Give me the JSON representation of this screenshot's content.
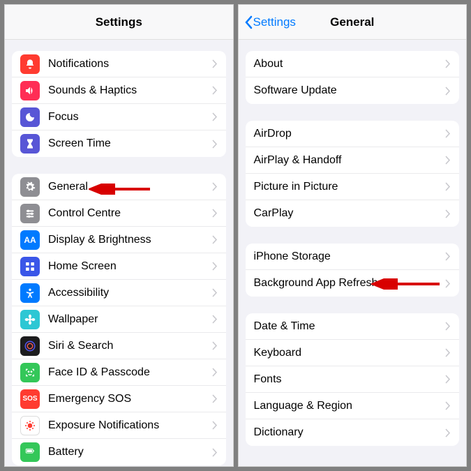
{
  "left": {
    "title": "Settings",
    "group1": [
      {
        "label": "Notifications",
        "bg": "#ff3b30",
        "icon": "bell"
      },
      {
        "label": "Sounds & Haptics",
        "bg": "#ff2d55",
        "icon": "speaker"
      },
      {
        "label": "Focus",
        "bg": "#5856d6",
        "icon": "moon"
      },
      {
        "label": "Screen Time",
        "bg": "#5856d6",
        "icon": "hourglass"
      }
    ],
    "group2": [
      {
        "label": "General",
        "bg": "#8e8e93",
        "icon": "gear"
      },
      {
        "label": "Control Centre",
        "bg": "#8e8e93",
        "icon": "sliders"
      },
      {
        "label": "Display & Brightness",
        "bg": "#007aff",
        "icon": "aa"
      },
      {
        "label": "Home Screen",
        "bg": "#3a56e8",
        "icon": "grid"
      },
      {
        "label": "Accessibility",
        "bg": "#007aff",
        "icon": "person"
      },
      {
        "label": "Wallpaper",
        "bg": "#2dc7d4",
        "icon": "flower"
      },
      {
        "label": "Siri & Search",
        "bg": "#1c1c1e",
        "icon": "siri"
      },
      {
        "label": "Face ID & Passcode",
        "bg": "#34c759",
        "icon": "face"
      },
      {
        "label": "Emergency SOS",
        "bg": "#ff3b30",
        "icon": "sos"
      },
      {
        "label": "Exposure Notifications",
        "bg": "#ffffff",
        "icon": "virus"
      },
      {
        "label": "Battery",
        "bg": "#34c759",
        "icon": "battery"
      }
    ]
  },
  "right": {
    "back": "Settings",
    "title": "General",
    "group1": [
      {
        "label": "About"
      },
      {
        "label": "Software Update"
      }
    ],
    "group2": [
      {
        "label": "AirDrop"
      },
      {
        "label": "AirPlay & Handoff"
      },
      {
        "label": "Picture in Picture"
      },
      {
        "label": "CarPlay"
      }
    ],
    "group3": [
      {
        "label": "iPhone Storage"
      },
      {
        "label": "Background App Refresh"
      }
    ],
    "group4": [
      {
        "label": "Date & Time"
      },
      {
        "label": "Keyboard"
      },
      {
        "label": "Fonts"
      },
      {
        "label": "Language & Region"
      },
      {
        "label": "Dictionary"
      }
    ]
  }
}
